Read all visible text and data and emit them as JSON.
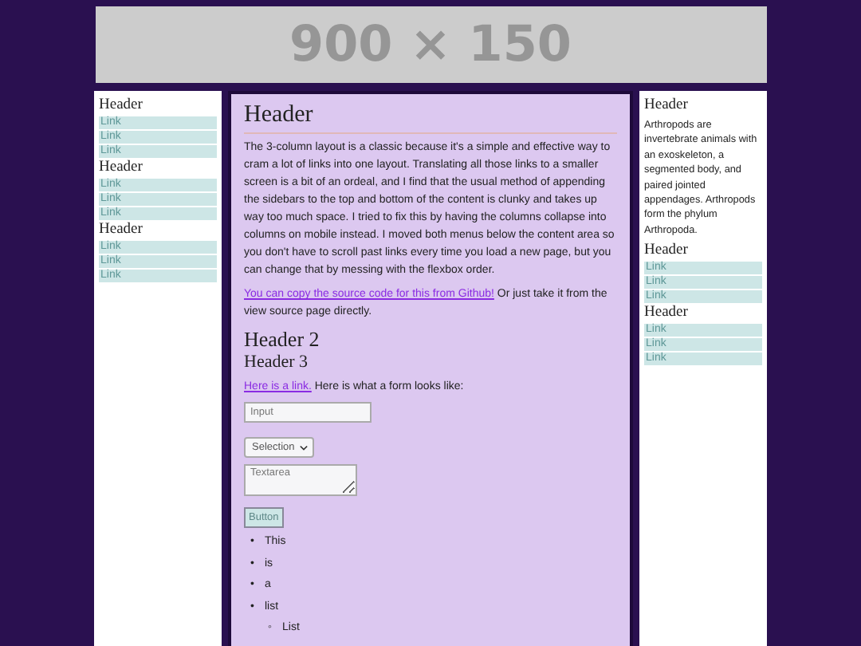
{
  "banner": {
    "text": "900 × 150"
  },
  "left_sidebar": {
    "sections": [
      {
        "header": "Header",
        "links": [
          "Link",
          "Link",
          "Link"
        ]
      },
      {
        "header": "Header",
        "links": [
          "Link",
          "Link",
          "Link"
        ]
      },
      {
        "header": "Header",
        "links": [
          "Link",
          "Link",
          "Link"
        ]
      }
    ]
  },
  "main": {
    "title": "Header",
    "paragraph": "The 3-column layout is a classic because it's a simple and effective way to cram a lot of links into one layout. Translating all those links to a smaller screen is a bit of an ordeal, and I find that the usual method of appending the sidebars to the top and bottom of the content is clunky and takes up way too much space. I tried to fix this by having the columns collapse into columns on mobile instead. I moved both menus below the content area so you don't have to scroll past links every time you load a new page, but you can change that by messing with the flexbox order.",
    "source_line": {
      "link": "You can copy the source code for this from Github!",
      "text": "Or just take it from the view source page directly."
    },
    "header_2": "Header 2",
    "header_3": "Header 3",
    "form_intro": {
      "link": "Here is a link.",
      "text": "Here is what a form looks like:"
    },
    "form": {
      "input_placeholder": "Input",
      "select_value": "Selection",
      "textarea_placeholder": "Textarea",
      "button": "Button"
    },
    "list": [
      {
        "marker": "•",
        "text": "This"
      },
      {
        "marker": "•",
        "text": "is"
      },
      {
        "marker": "•",
        "text": "a"
      },
      {
        "marker": "•",
        "text": "list",
        "children": [
          {
            "marker": "◦",
            "text": "List"
          }
        ]
      }
    ]
  },
  "right_sidebar": {
    "blocks": [
      {
        "kind": "text",
        "header": "Header",
        "text": "Arthropods are invertebrate animals with an exoskeleton, a segmented body, and paired jointed appendages. Arthropods form the phylum Arthropoda."
      },
      {
        "kind": "links",
        "header": "Header",
        "links": [
          "Link",
          "Link",
          "Link"
        ]
      },
      {
        "kind": "links",
        "header": "Header",
        "links": [
          "Link",
          "Link",
          "Link"
        ]
      }
    ]
  }
}
